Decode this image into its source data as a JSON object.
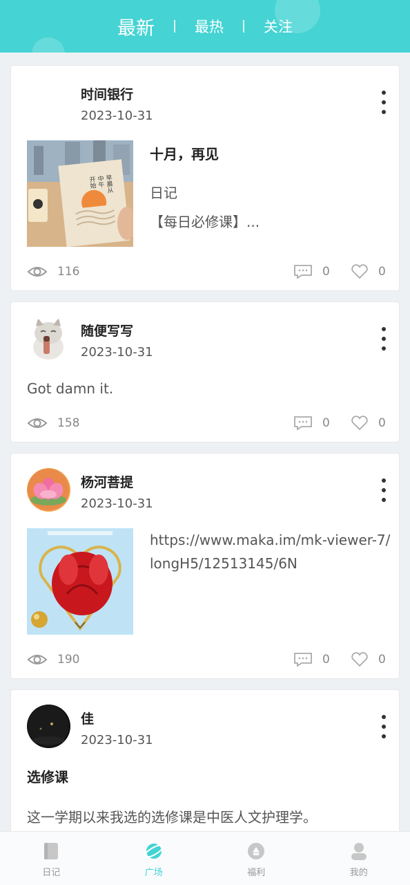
{
  "top_tabs": [
    {
      "label": "最新",
      "active": true
    },
    {
      "label": "最热",
      "active": false
    },
    {
      "label": "关注",
      "active": false
    }
  ],
  "colors": {
    "accent": "#45d3d3",
    "background": "#eef1f4",
    "card": "#ffffff"
  },
  "posts": [
    {
      "author": "时间银行",
      "date": "2023-10-31",
      "title": "十月，再见",
      "category": "日记",
      "excerpt": "【每日必修课】...",
      "views": "116",
      "comments": "0",
      "likes": "0",
      "thumbnail_text": [
        "早晨从",
        "中午",
        "开始"
      ]
    },
    {
      "author": "随便写写",
      "date": "2023-10-31",
      "body": "Got damn it.",
      "views": "158",
      "comments": "0",
      "likes": "0"
    },
    {
      "author": "杨河菩提",
      "date": "2023-10-31",
      "link": "https://www.maka.im/mk-viewer-7/longH5/12513145/6N",
      "views": "190",
      "comments": "0",
      "likes": "0"
    },
    {
      "author": "佳",
      "date": "2023-10-31",
      "title": "选修课",
      "body": "这一学期以来我选的选修课是中医人文护理学。"
    }
  ],
  "icons": {
    "views": "eye-icon",
    "comments": "comment-icon",
    "likes": "heart-icon",
    "menu": "more-vertical-icon"
  },
  "bottom_nav": [
    {
      "label": "日记",
      "icon": "diary-icon",
      "active": false
    },
    {
      "label": "广场",
      "icon": "planet-icon",
      "active": true
    },
    {
      "label": "福利",
      "icon": "welfare-icon",
      "active": false
    },
    {
      "label": "我的",
      "icon": "profile-icon",
      "active": false
    }
  ]
}
